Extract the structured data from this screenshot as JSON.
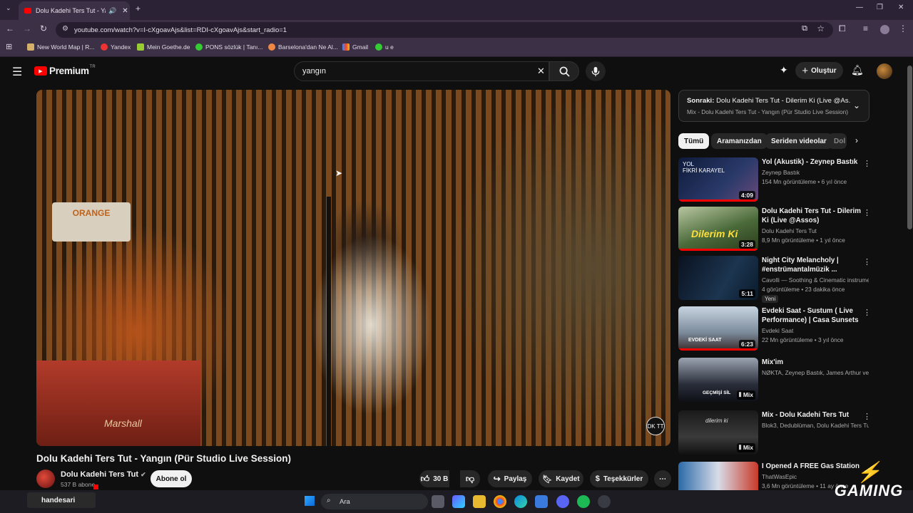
{
  "browser": {
    "tab_title": "Dolu Kadehi Ters Tut - Yang",
    "url": "youtube.com/watch?v=I-cXgoavAjs&list=RDI-cXgoavAjs&start_radio=1",
    "bookmarks": [
      "New World Map | R...",
      "Yandex",
      "Mein Goethe.de",
      "PONS sözlük | Tanı...",
      "Barselona'dan Ne Al...",
      "Gmail",
      "u e"
    ]
  },
  "youtube": {
    "logo_text": "Premium",
    "logo_region": "TR",
    "search_value": "yangın",
    "create_label": "Oluştur"
  },
  "video": {
    "amp_label": "ORANGE",
    "cab_label": "Marshall",
    "logo_label": "DK TT",
    "title": "Dolu Kadehi Ters Tut - Yangın (Pür Studio Live Session)",
    "channel": "Dolu Kadehi Ters Tut",
    "subs": "537 B abone",
    "subscribe_label": "Abone ol",
    "likes": "30 B",
    "share_label": "Paylaş",
    "save_label": "Kaydet",
    "thanks_label": "Teşekkürler"
  },
  "sidebar": {
    "next_label": "Sonraki:",
    "next_title": "Dolu Kadehi Ters Tut - Dilerim Ki (Live @As...",
    "next_sub": "Mix - Dolu Kadehi Ters Tut - Yangın (Pür Studio Live Session)",
    "chips": [
      "Tümü",
      "Aramanızdan",
      "Seriden videolar",
      "Dol"
    ],
    "videos": [
      {
        "title": "Yol (Akustik) - Zeynep Bastık",
        "channel": "Zeynep Bastık",
        "meta": "154 Mn görüntüleme • 6 yıl önce",
        "duration": "4:09",
        "thumb_text": "YOL\nFİKRİ KARAYEL"
      },
      {
        "title": "Dolu Kadehi Ters Tut - Dilerim Ki (Live @Assos)",
        "channel": "Dolu Kadehi Ters Tut",
        "meta": "8,9 Mn görüntüleme • 1 yıl önce",
        "duration": "3:28",
        "thumb_text": "Dilerim Ki"
      },
      {
        "title": "Night City Melancholy | #enstrümantalmüzik ...",
        "channel": "Cavolli — Soothing & Cinematic instrume...",
        "meta": "4 görüntüleme • 23 dakika önce",
        "duration": "5:11",
        "badge": "Yeni",
        "thumb_text": ""
      },
      {
        "title": "Evdeki Saat - Sustum ( Live Performance) | Casa Sunsets ...",
        "channel": "Evdeki Saat",
        "meta": "22 Mn görüntüleme • 3 yıl önce",
        "duration": "6:23",
        "thumb_text": "EVDEKİ SAAT"
      },
      {
        "title": "Mix'im",
        "channel": "NØKTA, Zeynep Bastık, James Arthur ve ...",
        "meta": "",
        "duration": "Mix",
        "thumb_text": "GEÇMİŞİ SİL"
      },
      {
        "title": "Mix - Dolu Kadehi Ters Tut",
        "channel": "Blok3, Dedublüman, Dolu Kadehi Ters Tut...",
        "meta": "",
        "duration": "Mix",
        "thumb_text": "dilerim ki"
      },
      {
        "title": "I Opened A FREE Gas Station",
        "channel": "ThatWasEpic",
        "meta": "3,6 Mn görüntüleme • 11 ay önce",
        "duration": "",
        "thumb_text": ""
      }
    ]
  },
  "overlay": {
    "streamer": "handesari",
    "brand": "GAMING"
  },
  "taskbar": {
    "search_label": "Ara"
  },
  "colors": {
    "accent": "#ff0000",
    "background": "#0f0f0f",
    "chrome": "#3b3045"
  }
}
